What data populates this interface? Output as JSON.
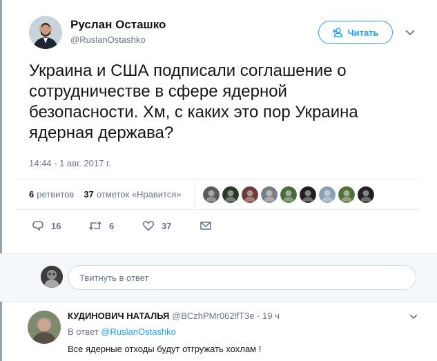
{
  "tweet": {
    "author_name": "Руслан Осташко",
    "author_handle": "@RuslanOstashko",
    "follow_label": "Читать",
    "text_lines": [
      "Украина и США подписали соглашение о",
      "сотрудничестве в сфере ядерной",
      "безопасности. Хм, с каких это пор Украина",
      "ядерная держава?"
    ],
    "timestamp": "14:44 - 1 авг. 2017 г.",
    "stats": {
      "retweets_count": "6",
      "retweets_label": "ретвитов",
      "likes_count": "37",
      "likes_label": "отметок «Нравится»"
    },
    "likers": [
      {
        "icon": "user-avatar-1",
        "color": "#5b5b5b"
      },
      {
        "icon": "user-avatar-2",
        "color": "#2b3a2a"
      },
      {
        "icon": "user-avatar-3",
        "color": "#6e3b3b"
      },
      {
        "icon": "user-avatar-4",
        "color": "#7a7f86"
      },
      {
        "icon": "user-avatar-5",
        "color": "#4a6b3a"
      },
      {
        "icon": "user-avatar-6",
        "color": "#1f1f1f"
      },
      {
        "icon": "user-avatar-7",
        "color": "#8aa0b5"
      },
      {
        "icon": "user-avatar-8",
        "color": "#56703c"
      },
      {
        "icon": "user-avatar-9",
        "color": "#222222"
      }
    ],
    "actions": {
      "replies": "16",
      "retweets": "6",
      "likes": "37"
    }
  },
  "reply_box": {
    "placeholder": "Твитнуть в ответ"
  },
  "reply": {
    "author_name": "КУДИНОВИЧ НАТАЛЬЯ",
    "author_handle": "@BCzhPMr062lfT3e",
    "separator": "·",
    "time": "19 ч",
    "replying_prefix": "В ответ",
    "replying_to": "@RuslanOstashko",
    "text": "Все ядерные отходы будут отгружать хохлам !"
  },
  "colors": {
    "accent": "#1da1f2",
    "secondary_text": "#657786",
    "border": "#e6ecf0"
  }
}
